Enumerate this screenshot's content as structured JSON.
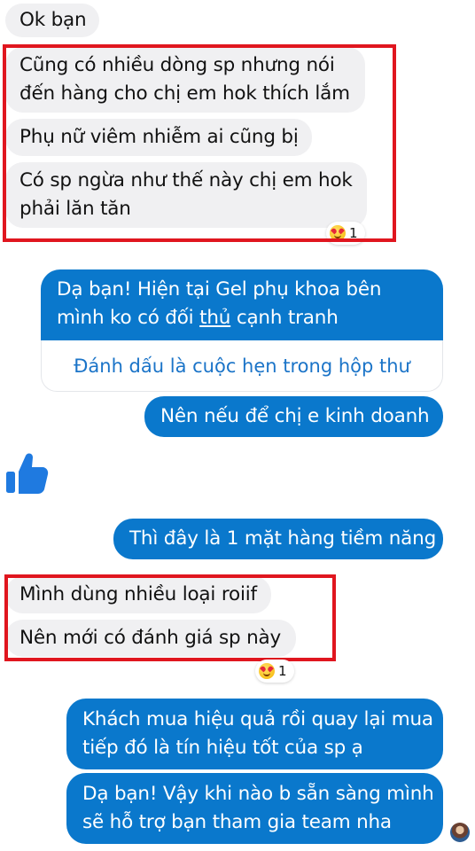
{
  "messages": {
    "incoming_1": "Ok bạn",
    "incoming_2_line_1": "Cũng có nhiều dòng sp nhưng nói",
    "incoming_2_line_2": "đến hàng cho chị em hok thích lắm",
    "incoming_3": "Phụ nữ viêm nhiễm ai cũng bị",
    "incoming_4_line_1": "Có sp ngừa như thế này chị em hok",
    "incoming_4_line_2": "phải lăn tăn",
    "reaction_1_count": "1",
    "outgoing_1_line_1": "Dạ bạn! Hiện tại Gel phụ khoa bên",
    "outgoing_1_line_2_before": "mình ko có đối ",
    "outgoing_1_line_2_underlined": "thủ",
    "outgoing_1_line_2_after": " cạnh tranh",
    "action_link": "Đánh dấu là cuộc hẹn trong hộp thư",
    "outgoing_2": "Nên nếu để chị e kinh doanh",
    "like_icon": "thumbs-up-icon",
    "outgoing_3": "Thì đây là 1 mặt hàng tiềm năng",
    "incoming_5": "Mình dùng nhiều loại roiif",
    "incoming_6": "Nên mới có đánh giá sp này",
    "reaction_2_count": "1",
    "outgoing_4_line_1": "Khách mua hiệu quả rồi quay lại mua",
    "outgoing_4_line_2": "tiếp đó là tín hiệu tốt của sp ạ",
    "outgoing_5_line_1": "Dạ bạn! Vậy khi nào b sẵn sàng mình",
    "outgoing_5_line_2": "sẽ hỗ trợ bạn tham gia team nha"
  },
  "colors": {
    "incoming_bubble": "#f0f0f2",
    "outgoing_bubble": "#0a78cc",
    "highlight_border": "#e0161f",
    "link_text": "#1b74c8"
  }
}
